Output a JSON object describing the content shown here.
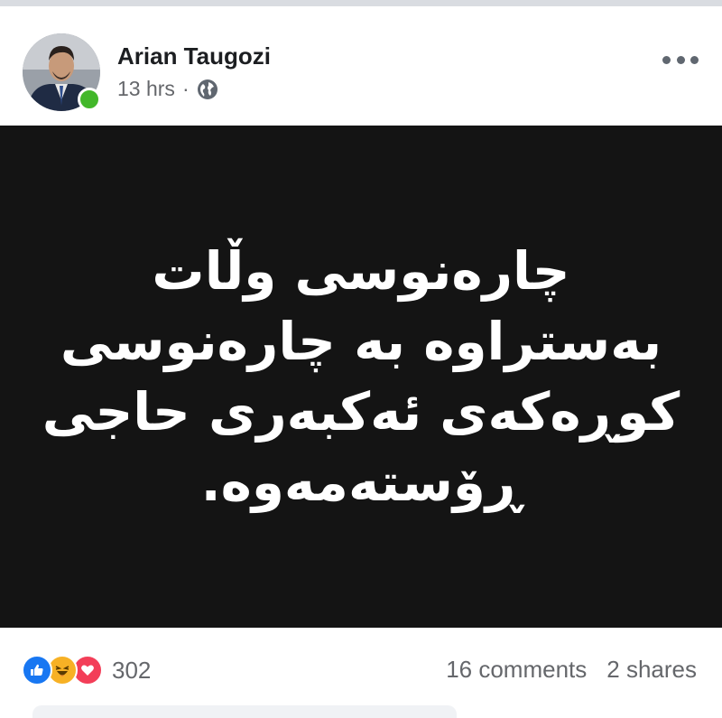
{
  "post": {
    "author": "Arian Taugozi",
    "time": "13 hrs",
    "separator": "·",
    "privacy_icon": "globe-icon",
    "text_lines": [
      "چارەنوسی وڵات",
      "بەستراوە بە چارەنوسی",
      "کوڕەکەی ئەکبەری حاجی",
      "ڕۆستەمەوە."
    ]
  },
  "footer": {
    "reaction_icons": [
      "like-reaction-icon",
      "haha-reaction-icon",
      "love-reaction-icon"
    ],
    "reaction_count": "302",
    "comments": "16 comments",
    "shares": "2 shares"
  },
  "colors": {
    "like": "#1877f2",
    "haha": "#f7b125",
    "love": "#f33e58",
    "online": "#42b72a",
    "image_bg": "#141414"
  }
}
